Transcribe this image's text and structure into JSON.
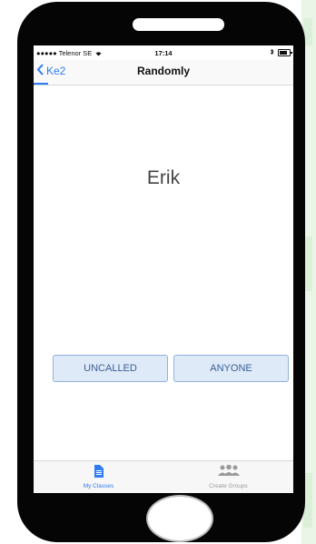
{
  "status_bar": {
    "carrier": "●●●●● Telenor SE",
    "time": "17:14"
  },
  "nav": {
    "back_label": "Ke2",
    "title": "Randomly"
  },
  "main": {
    "student_name": "Erik"
  },
  "buttons": {
    "uncalled": "UNCALLED",
    "anyone": "ANYONE"
  },
  "tabs": [
    {
      "label": "My Classes",
      "icon": "document-icon",
      "active": true
    },
    {
      "label": "Create Groups",
      "icon": "group-icon",
      "active": false
    }
  ],
  "colors": {
    "accent": "#2f7cf6",
    "button_bg": "#dfeaf8",
    "button_text": "#3a5f94"
  }
}
